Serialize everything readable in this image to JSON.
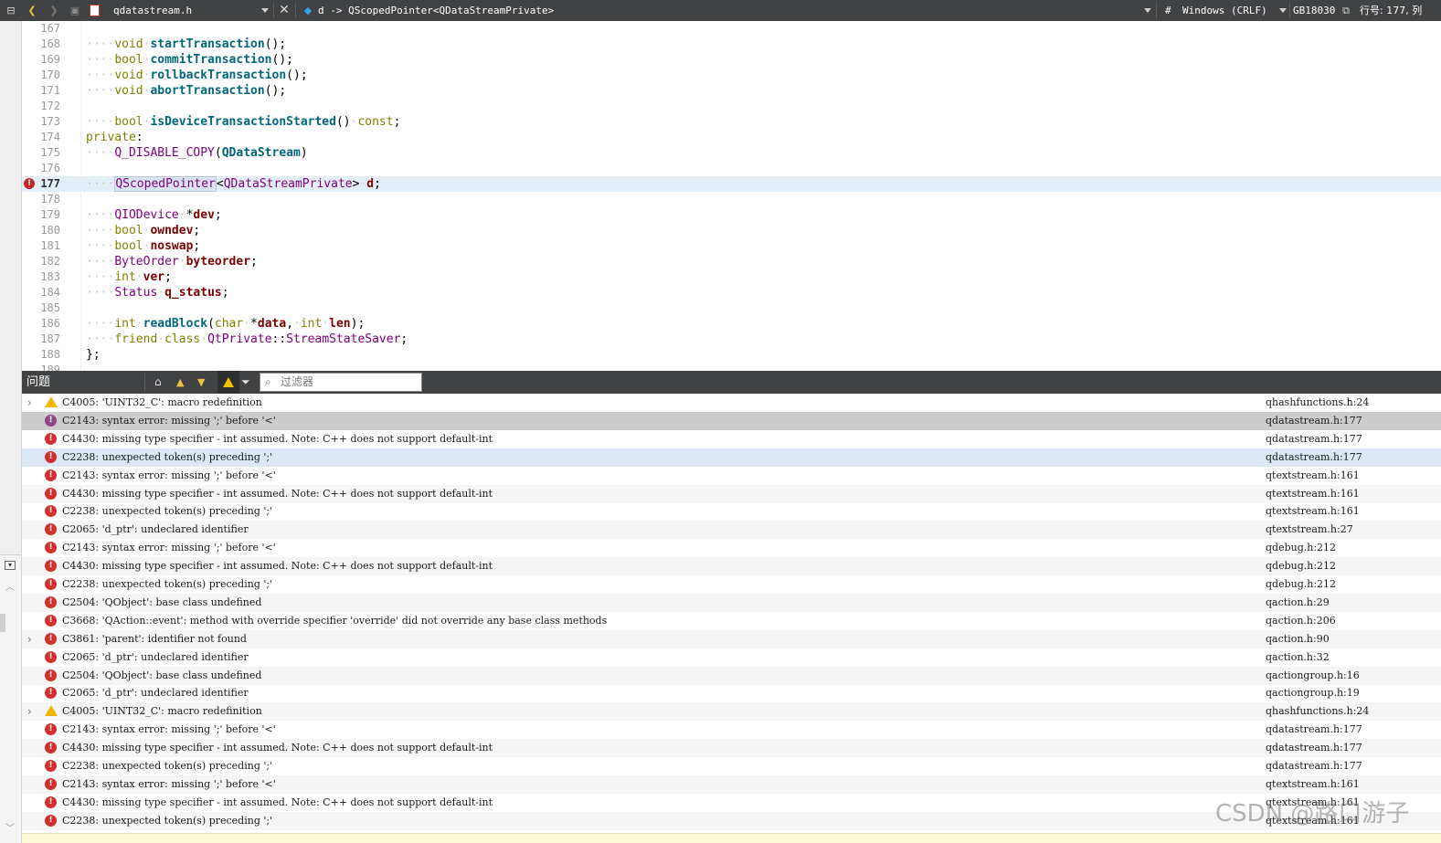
{
  "toolbar": {
    "file_name": "qdatastream.h",
    "symbol": "d -> QScopedPointer<QDataStreamPrivate>",
    "hash_label": "#",
    "line_endings": "Windows (CRLF)",
    "encoding": "GB18030",
    "position": "行号: 177, 列"
  },
  "editor": {
    "lines": [
      {
        "n": "167",
        "html": ""
      },
      {
        "n": "168",
        "html": "<span class='ws'>····</span><span class='kw'>void</span><span class='ws'>·</span><span class='fn'>startTransaction</span>();"
      },
      {
        "n": "169",
        "html": "<span class='ws'>····</span><span class='kw'>bool</span><span class='ws'>·</span><span class='fn'>commitTransaction</span>();"
      },
      {
        "n": "170",
        "html": "<span class='ws'>····</span><span class='kw'>void</span><span class='ws'>·</span><span class='fn'>rollbackTransaction</span>();"
      },
      {
        "n": "171",
        "html": "<span class='ws'>····</span><span class='kw'>void</span><span class='ws'>·</span><span class='fn'>abortTransaction</span>();"
      },
      {
        "n": "172",
        "html": ""
      },
      {
        "n": "173",
        "html": "<span class='ws'>····</span><span class='kw'>bool</span><span class='ws'>·</span><span class='fn'>isDeviceTransactionStarted</span>()<span class='ws'>·</span><span class='kw'>const</span>;"
      },
      {
        "n": "174",
        "html": "<span class='pv'>private</span>:"
      },
      {
        "n": "175",
        "html": "<span class='ws'>····</span><span class='mc'>Q_DISABLE_COPY</span>(<span class='fn'>QDataStream</span>)"
      },
      {
        "n": "176",
        "html": ""
      },
      {
        "n": "177",
        "html": "<span class='ws'>····</span><span class='ty hl'>QScopedPointer</span>&lt;<span class='ty'>QDataStreamPrivate</span>&gt;<span class='ws'>·</span><span class='mb'>d</span>;",
        "current": true,
        "error": true
      },
      {
        "n": "178",
        "html": ""
      },
      {
        "n": "179",
        "html": "<span class='ws'>····</span><span class='ty'>QIODevice</span><span class='ws'>·</span>*<span class='mb'>dev</span>;"
      },
      {
        "n": "180",
        "html": "<span class='ws'>····</span><span class='kw'>bool</span><span class='ws'>·</span><span class='mb'>owndev</span>;"
      },
      {
        "n": "181",
        "html": "<span class='ws'>····</span><span class='kw'>bool</span><span class='ws'>·</span><span class='mb'>noswap</span>;"
      },
      {
        "n": "182",
        "html": "<span class='ws'>····</span><span class='ty'>ByteOrder</span><span class='ws'>·</span><span class='mb'>byteorder</span>;"
      },
      {
        "n": "183",
        "html": "<span class='ws'>····</span><span class='kw'>int</span><span class='ws'>·</span><span class='mb'>ver</span>;"
      },
      {
        "n": "184",
        "html": "<span class='ws'>····</span><span class='ty'>Status</span><span class='ws'>·</span><span class='mb'>q_status</span>;"
      },
      {
        "n": "185",
        "html": ""
      },
      {
        "n": "186",
        "html": "<span class='ws'>····</span><span class='kw'>int</span><span class='ws'>·</span><span class='fn'>readBlock</span>(<span class='kw'>char</span><span class='ws'>·</span>*<span class='mb'>data</span>,<span class='ws'>·</span><span class='kw'>int</span><span class='ws'>·</span><span class='mb'>len</span>);"
      },
      {
        "n": "187",
        "html": "<span class='ws'>····</span><span class='kw'>friend</span><span class='ws'>·</span><span class='kw'>class</span><span class='ws'>·</span><span class='ty'>QtPrivate</span>::<span class='ty'>StreamStateSaver</span>;"
      },
      {
        "n": "188",
        "html": "};"
      },
      {
        "n": "189",
        "html": ""
      }
    ]
  },
  "issues_pane": {
    "title": "问题",
    "filter_placeholder": "过滤器",
    "items": [
      {
        "type": "warning",
        "expand": true,
        "msg": "C4005: 'UINT32_C': macro redefinition",
        "loc": "qhashfunctions.h:24"
      },
      {
        "type": "error",
        "selected": true,
        "msg": "C2143: syntax error: missing ';' before '<'",
        "loc": "qdatastream.h:177"
      },
      {
        "type": "error",
        "msg": "C4430: missing type specifier - int assumed. Note: C++ does not support default-int",
        "loc": "qdatastream.h:177"
      },
      {
        "type": "error",
        "hover": true,
        "msg": "C2238: unexpected token(s) preceding ';'",
        "loc": "qdatastream.h:177"
      },
      {
        "type": "error",
        "msg": "C2143: syntax error: missing ';' before '<'",
        "loc": "qtextstream.h:161"
      },
      {
        "type": "error",
        "msg": "C4430: missing type specifier - int assumed. Note: C++ does not support default-int",
        "loc": "qtextstream.h:161"
      },
      {
        "type": "error",
        "msg": "C2238: unexpected token(s) preceding ';'",
        "loc": "qtextstream.h:161"
      },
      {
        "type": "error",
        "msg": "C2065: 'd_ptr': undeclared identifier",
        "loc": "qtextstream.h:27"
      },
      {
        "type": "error",
        "msg": "C2143: syntax error: missing ';' before '<'",
        "loc": "qdebug.h:212"
      },
      {
        "type": "error",
        "msg": "C4430: missing type specifier - int assumed. Note: C++ does not support default-int",
        "loc": "qdebug.h:212"
      },
      {
        "type": "error",
        "msg": "C2238: unexpected token(s) preceding ';'",
        "loc": "qdebug.h:212"
      },
      {
        "type": "error",
        "msg": "C2504: 'QObject': base class undefined",
        "loc": "qaction.h:29"
      },
      {
        "type": "error",
        "msg": "C3668: 'QAction::event': method with override specifier 'override' did not override any base class methods",
        "loc": "qaction.h:206"
      },
      {
        "type": "error",
        "expand": true,
        "msg": "C3861: 'parent': identifier not found",
        "loc": "qaction.h:90"
      },
      {
        "type": "error",
        "msg": "C2065: 'd_ptr': undeclared identifier",
        "loc": "qaction.h:32"
      },
      {
        "type": "error",
        "msg": "C2504: 'QObject': base class undefined",
        "loc": "qactiongroup.h:16"
      },
      {
        "type": "error",
        "msg": "C2065: 'd_ptr': undeclared identifier",
        "loc": "qactiongroup.h:19"
      },
      {
        "type": "warning",
        "expand": true,
        "msg": "C4005: 'UINT32_C': macro redefinition",
        "loc": "qhashfunctions.h:24"
      },
      {
        "type": "error",
        "msg": "C2143: syntax error: missing ';' before '<'",
        "loc": "qdatastream.h:177"
      },
      {
        "type": "error",
        "msg": "C4430: missing type specifier - int assumed. Note: C++ does not support default-int",
        "loc": "qdatastream.h:177"
      },
      {
        "type": "error",
        "msg": "C2238: unexpected token(s) preceding ';'",
        "loc": "qdatastream.h:177"
      },
      {
        "type": "error",
        "msg": "C2143: syntax error: missing ';' before '<'",
        "loc": "qtextstream.h:161"
      },
      {
        "type": "error",
        "msg": "C4430: missing type specifier - int assumed. Note: C++ does not support default-int",
        "loc": "qtextstream.h:161"
      },
      {
        "type": "error",
        "msg": "C2238: unexpected token(s) preceding ';'",
        "loc": "qtextstream.h:161"
      }
    ]
  },
  "watermark": "CSDN @路口游子",
  "colors": {
    "toolbar_bg": "#404244",
    "error_red": "#d32f2f",
    "warning_yellow": "#f2b600",
    "current_line": "#e4eef9"
  }
}
